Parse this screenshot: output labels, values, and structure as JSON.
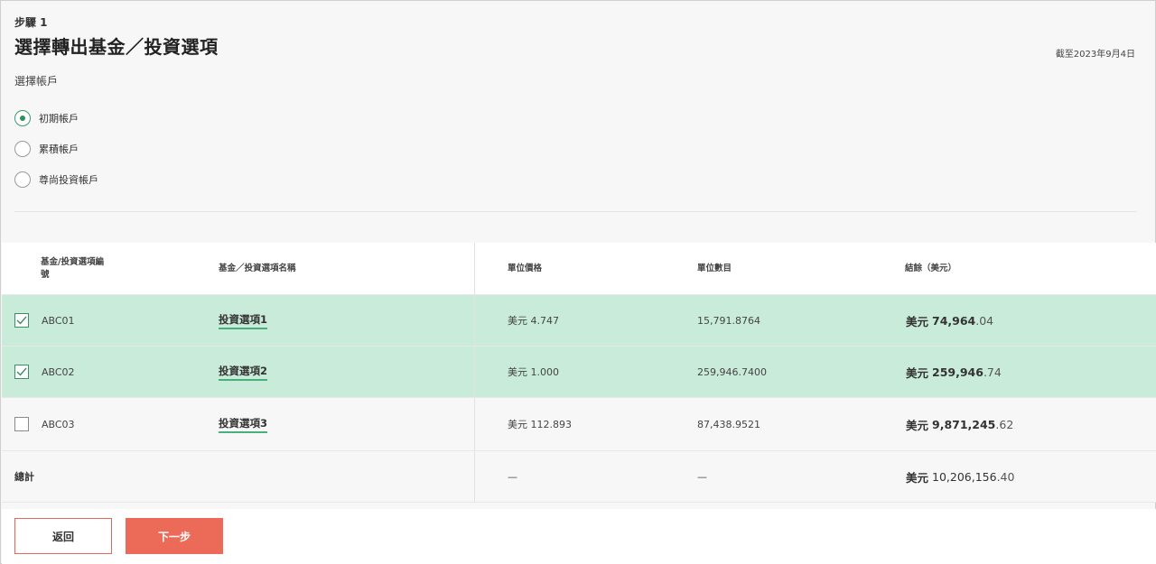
{
  "header": {
    "step": "步驟 1",
    "title": "選擇轉出基金／投資選項",
    "as_of": "截至2023年9月4日"
  },
  "account": {
    "label": "選擇帳戶",
    "options": [
      {
        "label": "初期帳戶",
        "selected": true
      },
      {
        "label": "累積帳戶",
        "selected": false
      },
      {
        "label": "尊尚投資帳戶",
        "selected": false
      }
    ]
  },
  "table": {
    "headers": {
      "code": "基金/投資選項編號",
      "name": "基金／投資選項名稱",
      "unit_price": "單位價格",
      "units": "單位數目",
      "balance": "結餘（美元）"
    },
    "rows": [
      {
        "checked": true,
        "code": "ABC01",
        "name": "投資選項1",
        "unit_price": "美元 4.747",
        "units": "15,791.8764",
        "bal_cur": "美元",
        "bal_int": "74,964",
        "bal_dec": ".04"
      },
      {
        "checked": true,
        "code": "ABC02",
        "name": "投資選項2",
        "unit_price": "美元 1.000",
        "units": "259,946.7400",
        "bal_cur": "美元",
        "bal_int": "259,946",
        "bal_dec": ".74"
      },
      {
        "checked": false,
        "code": "ABC03",
        "name": "投資選項3",
        "unit_price": "美元 112.893",
        "units": "87,438.9521",
        "bal_cur": "美元",
        "bal_int": "9,871,245",
        "bal_dec": ".62"
      }
    ],
    "total": {
      "label": "總計",
      "unit_price": "—",
      "units": "—",
      "bal_cur": "美元",
      "bal_int": "10,206,156",
      "bal_dec": ".40"
    }
  },
  "buttons": {
    "back": "返回",
    "next": "下一步"
  },
  "colors": {
    "selected_row": "#c9ebd9",
    "accent_green": "#49b07c",
    "primary_button": "#ec6a58"
  }
}
